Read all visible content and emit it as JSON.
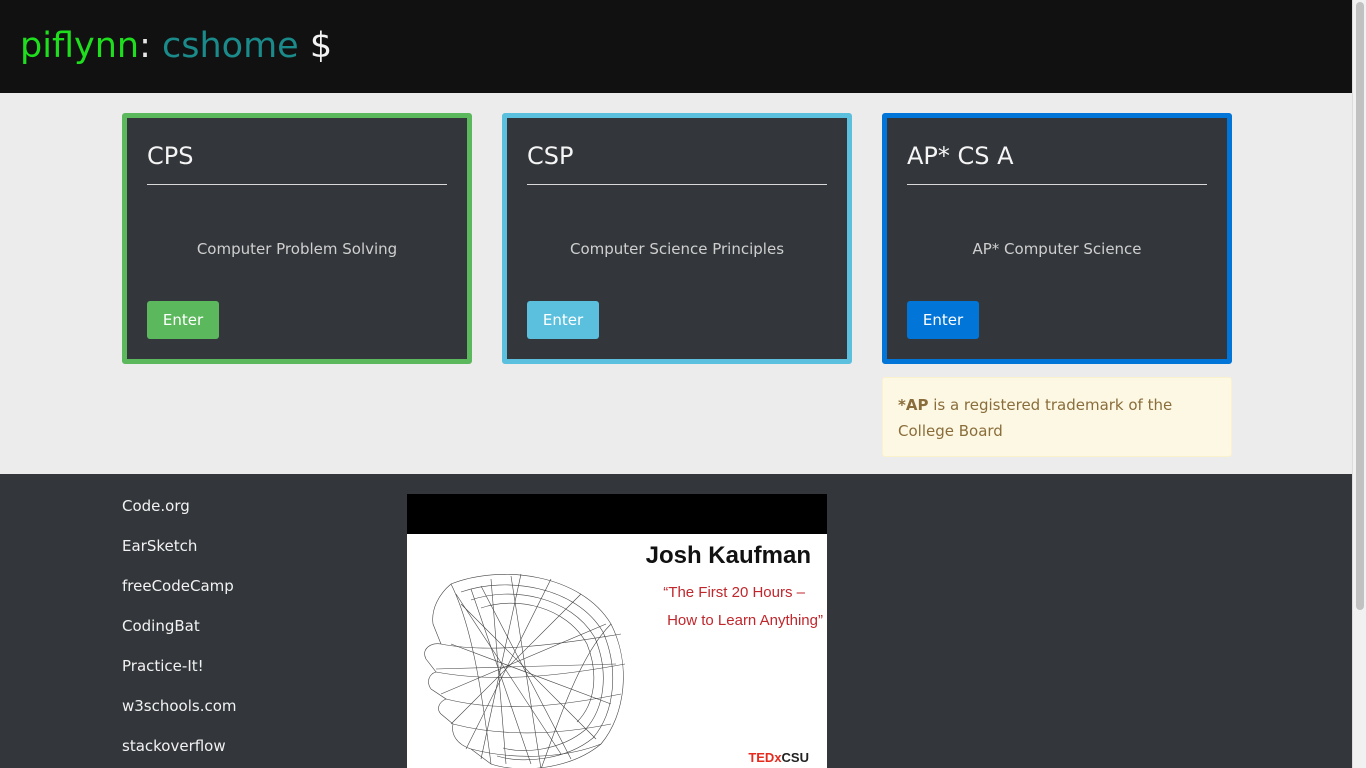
{
  "header": {
    "user": "piflynn",
    "colon": ":",
    "host": "cshome",
    "prompt": "$"
  },
  "cards": [
    {
      "title": "CPS",
      "description": "Computer Problem Solving",
      "button": "Enter",
      "color": "#5cb85c"
    },
    {
      "title": "CSP",
      "description": "Computer Science Principles",
      "button": "Enter",
      "color": "#5bc0de"
    },
    {
      "title": "AP* CS A",
      "description": "AP* Computer Science",
      "button": "Enter",
      "color": "#0275d8"
    }
  ],
  "notice": {
    "bold": "*AP",
    "text": " is a registered trademark of the College Board"
  },
  "footer": {
    "links": [
      "Code.org",
      "EarSketch",
      "freeCodeCamp",
      "CodingBat",
      "Practice-It!",
      "w3schools.com",
      "stackoverflow"
    ]
  },
  "video": {
    "name": "Josh Kaufman",
    "quote_line1": "“The First 20 Hours –",
    "quote_line2": "How to Learn Anything”",
    "logo_ted": "TEDx",
    "logo_rest": "CSU"
  }
}
